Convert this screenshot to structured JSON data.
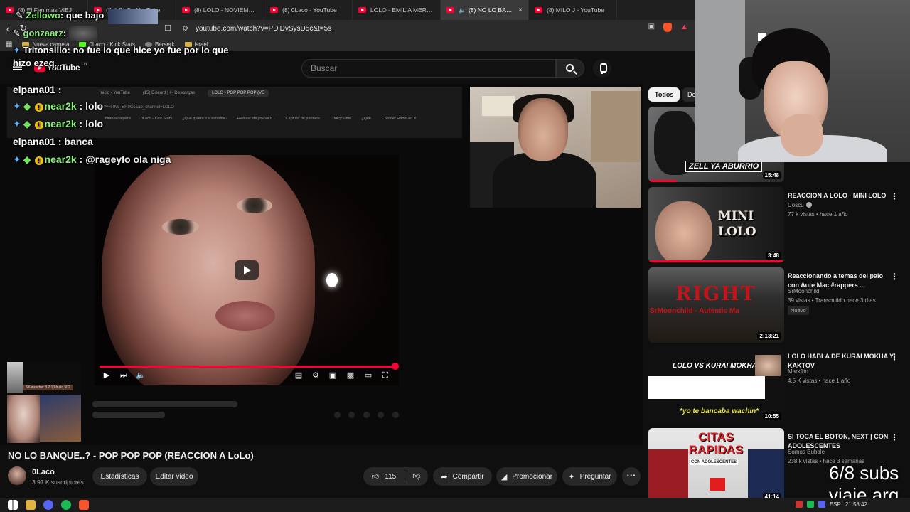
{
  "browser": {
    "tabs": [
      {
        "label": "(8) El Fan más VIEJO de LOLO - YouTube",
        "active": false
      },
      {
        "label": "(8) LOLO - YouTube",
        "active": false
      },
      {
        "label": "(8) LOLO - NOVIEMBRE (V",
        "active": false
      },
      {
        "label": "(8) 0Laco - YouTube",
        "active": false
      },
      {
        "label": "LOLO - EMILIA MERNES (",
        "active": false
      },
      {
        "label": "(8) NO LO BANQU",
        "active": true,
        "close": "×"
      },
      {
        "label": "(8) MILO J - YouTube",
        "active": false
      }
    ],
    "url": "youtube.com/watch?v=PDiDvSysD5c&t=5s",
    "bookmarks": [
      "Nueva carpeta",
      "0Laco - Kick Stats",
      "Berserk",
      "israel"
    ]
  },
  "youtube": {
    "logo_text": "YouTube",
    "logo_country": "UY",
    "search_placeholder": "Buscar"
  },
  "inner_browser": {
    "tabs": [
      "Inicio - YouTube",
      "(15) Discord | #- Descargas",
      "LOLO - POP POP POP (VE"
    ],
    "url": "watch?v=i-9W_BH9Cc&ab_channel=LOLO",
    "bookmarks": [
      "Nueva carpeta",
      "0Laco - Kick Stats",
      "¿Qué quiero ir a estudiar?",
      "Realest shi you've h...",
      "Captura de pantalla...",
      "Juicy Time",
      "¿Qué...",
      "Stoner Radio en X"
    ]
  },
  "chat": {
    "lines": [
      {
        "user": "elpana01",
        "sep": " :",
        "msg": "",
        "green": false,
        "badges": false
      },
      {
        "user": "near2k",
        "sep": " : ",
        "msg": "lolo",
        "green": true,
        "badges": true
      },
      {
        "user": "near2k",
        "sep": " : ",
        "msg": "lolo",
        "green": true,
        "badges": true
      },
      {
        "user": "elpana01",
        "sep": " : ",
        "msg": "banca",
        "green": false,
        "badges": false
      },
      {
        "user": "near2k",
        "sep": " : ",
        "msg": "@rageylo ola niga",
        "green": true,
        "badges": true
      }
    ]
  },
  "overlay_chat": {
    "lines": [
      {
        "user": "",
        "msg": "(8) El Fan más VIEJO de LOLO"
      },
      {
        "user": "Zellowo",
        "msg": ": que bajo"
      },
      {
        "user": "gonzaarz",
        "msg": ":"
      },
      {
        "user": "Tritonsillo",
        "msg": ": no fue lo que hice yo fue por lo que"
      },
      {
        "user": "",
        "msg": "hizo ezeq..."
      }
    ]
  },
  "player": {
    "progress_percent": 100,
    "launcher_label": "SKlauncher 3.2.10 build 502"
  },
  "video": {
    "title": "NO LO BANQUE..? - POP POP POP (REACCION A LoLo)",
    "channel": "0Laco",
    "subscribers": "3.97 K suscriptores",
    "stats_btn": "Estadísticas",
    "edit_btn": "Editar video",
    "likes": "115",
    "share_btn": "Compartir",
    "promote_btn": "Promocionar",
    "ask_btn": "Preguntar",
    "more_btn": "···"
  },
  "sidebar": {
    "chips": [
      "Todos",
      "De"
    ],
    "items": [
      {
        "title": "",
        "channel": "",
        "meta": "",
        "duration": "15:48",
        "thumb_text": "ZELL YA ABURRIO",
        "badge": ""
      },
      {
        "title": "REACCION A LOLO - MINI LOLO",
        "channel": "Coscu",
        "meta": "77 k vistas • hace 1 año",
        "duration": "3:48",
        "thumb_text": "MINI LOLO",
        "badge": ""
      },
      {
        "title": "Reaccionando a temas del palo con Aute Mac #rappers ...",
        "channel": "SrMoonchild",
        "meta": "39 vistas • Transmitido hace 3 días",
        "duration": "2:13:21",
        "thumb_text": "RIGHT",
        "thumb_sub": "SrMoonchild - Autentic Ma",
        "badge": "Nuevo"
      },
      {
        "title": "LOLO HABLA DE KURAI MOKHA Y KAKTOV",
        "channel": "Mark1to",
        "meta": "4.5 K vistas • hace 1 año",
        "duration": "10:55",
        "thumb_text": "LOLO VS KURAI MOKHA",
        "thumb_sub": "*yo te bancaba wachin*",
        "badge": ""
      },
      {
        "title": "SI TOCA EL BOTON, NEXT | CON ADOLESCENTES",
        "channel": "Somos Bubble",
        "meta": "238 k vistas • hace 3 semanas",
        "duration": "41:14",
        "thumb_text": "CITAS RAPIDAS",
        "thumb_sub": "CON ADOLESCENTES",
        "badge": ""
      }
    ]
  },
  "stream_overlay": {
    "line1": "6/8 subs",
    "line2": "viaje arg"
  },
  "taskbar": {
    "lang": "ESP",
    "time": "21:58:42"
  },
  "colors": {
    "yt_red": "#ff0033",
    "bg": "#0f0f0f",
    "chat_green": "#8cf07a"
  }
}
